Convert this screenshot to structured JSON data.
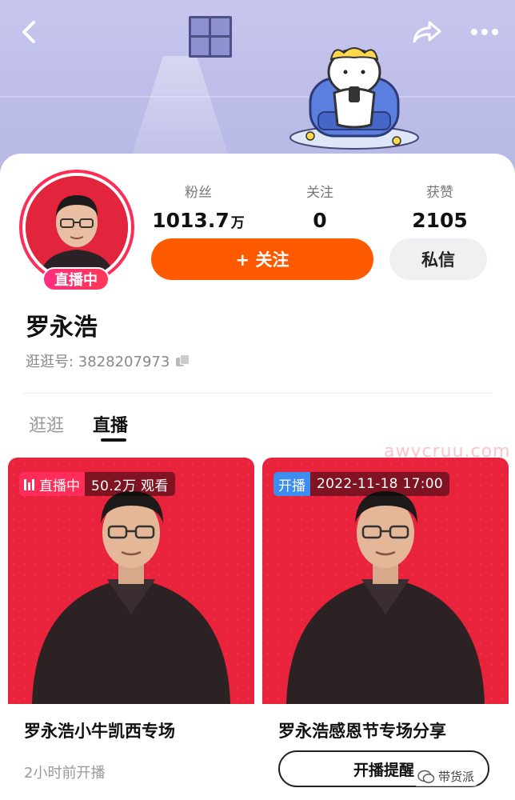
{
  "profile": {
    "live_tag": "直播中",
    "name": "罗永浩",
    "id_line": "逛逛号: 3828207973"
  },
  "stats": {
    "fans": {
      "label": "粉丝",
      "value": "1013.7",
      "unit": "万"
    },
    "following": {
      "label": "关注",
      "value": "0"
    },
    "likes": {
      "label": "获赞",
      "value": "2105"
    }
  },
  "actions": {
    "follow_label": "+ 关注",
    "message_label": "私信"
  },
  "tabs": [
    {
      "label": "逛逛",
      "active": false
    },
    {
      "label": "直播",
      "active": true
    }
  ],
  "cards": [
    {
      "badge_type": "直播中",
      "badge_info": "50.2万 观看",
      "title": "罗永浩小牛凯西专场",
      "subtitle": "2小时前开播"
    },
    {
      "badge_type": "开播",
      "badge_info": "2022-11-18 17:00",
      "title": "罗永浩感恩节专场分享",
      "button_label": "开播提醒"
    }
  ],
  "watermark": {
    "url": "awycruu.com",
    "brand": "带货派"
  },
  "colors": {
    "accent": "#ff5a00",
    "live_pink": "#ff2d55",
    "card_red": "#e9233c",
    "banner": "#c7c6ee"
  }
}
